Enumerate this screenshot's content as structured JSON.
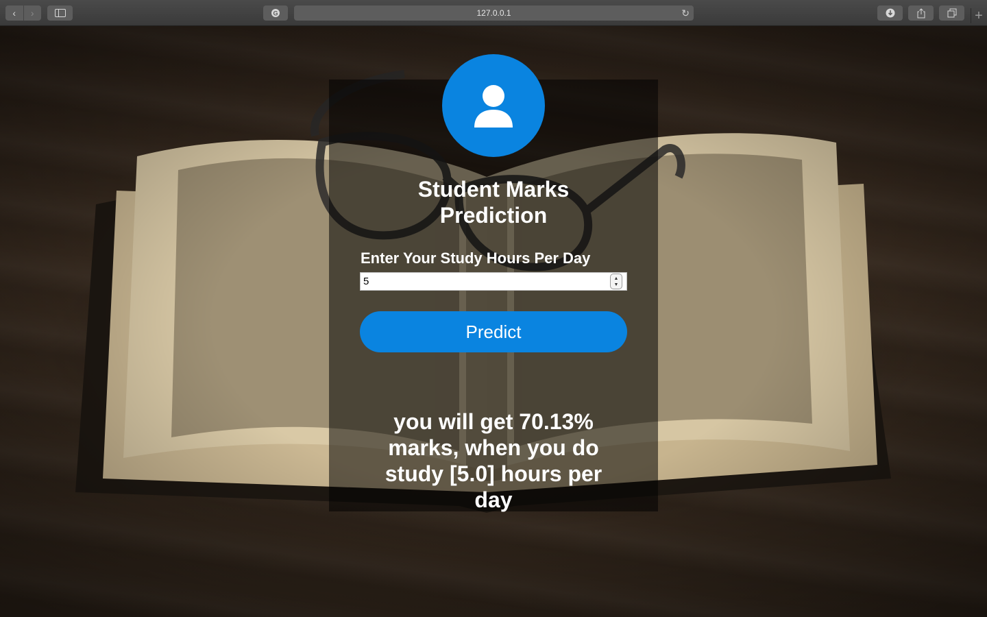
{
  "browser": {
    "url": "127.0.0.1",
    "icons": {
      "back": "chevron-left-icon",
      "forward": "chevron-right-icon",
      "sidebar": "sidebar-icon",
      "reader": "reader-icon",
      "reload": "reload-icon",
      "download": "download-icon",
      "share": "share-icon",
      "tabs": "tabs-icon",
      "new_tab": "plus-icon"
    }
  },
  "form": {
    "avatar_icon": "user-icon",
    "title_line1": "Student Marks",
    "title_line2": "Prediction",
    "field_label": "Enter Your Study Hours Per Day",
    "hours_value": "5",
    "predict_label": "Predict"
  },
  "result": {
    "text": "you will get 70.13% marks, when you do study [5.0] hours per day"
  },
  "colors": {
    "accent": "#0a84e0",
    "card_overlay": "rgba(0,0,0,0.52)",
    "text": "#ffffff"
  }
}
